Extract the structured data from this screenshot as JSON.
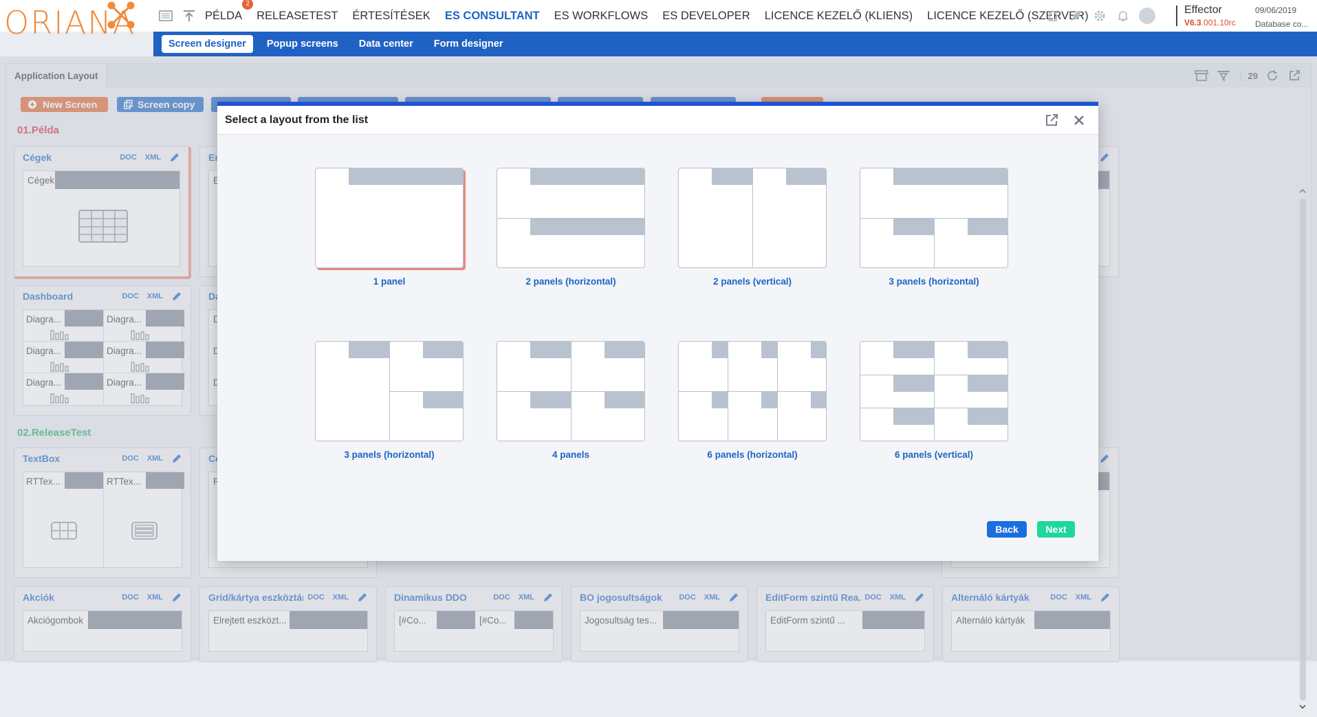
{
  "brand": {
    "logo_text": "ORIANA"
  },
  "nav": {
    "items": [
      {
        "label": "PÉLDA",
        "badge": "2"
      },
      {
        "label": "RELEASETEST"
      },
      {
        "label": "ÉRTESÍTÉSEK"
      },
      {
        "label": "ES CONSULTANT",
        "active": true
      },
      {
        "label": "ES WORKFLOWS"
      },
      {
        "label": "ES DEVELOPER"
      },
      {
        "label": "LICENCE KEZELŐ (KLIENS)"
      },
      {
        "label": "LICENCE KEZELŐ (SZERVER)"
      }
    ]
  },
  "app": {
    "name": "Effector",
    "version_main": "V6.3",
    "version_rest": ".001.10rc",
    "date": "09/06/2019",
    "database": "Database co..."
  },
  "subnav": {
    "items": [
      "Screen designer",
      "Popup screens",
      "Data center",
      "Form designer"
    ]
  },
  "tab": {
    "title": "Application Layout",
    "page_count": "29"
  },
  "toolbar": {
    "new_screen": "New Screen",
    "screen_copy": "Screen copy"
  },
  "groups": {
    "g1": "01.Példa",
    "g2": "02.ReleaseTest"
  },
  "cards": {
    "cegek": {
      "title": "Cégek",
      "doc": "DOC",
      "xml": "XML",
      "label": "Cégek"
    },
    "en": {
      "title": "En",
      "label": "E"
    },
    "dashboard": {
      "title": "Dashboard",
      "doc": "DOC",
      "xml": "XML",
      "cells": [
        "Diagra...",
        "Diagra...",
        "Diagra...",
        "Diagra...",
        "Diagra...",
        "Diagra..."
      ]
    },
    "da": {
      "title": "Da",
      "cells": [
        "D",
        "D",
        "D"
      ]
    },
    "textbox": {
      "title": "TextBox",
      "doc": "DOC",
      "xml": "XML",
      "cells": [
        "RTTex...",
        "RTTex..."
      ]
    },
    "co": {
      "title": "Co",
      "label": "R"
    },
    "akciok": {
      "title": "Akciók",
      "doc": "DOC",
      "xml": "XML",
      "label": "Akciógombok"
    },
    "grid": {
      "title": "Grid/kártya eszköztár",
      "doc": "DOC",
      "xml": "XML",
      "label": "Elrejtett eszközt..."
    },
    "ddo": {
      "title": "Dinamikus DDO",
      "doc": "DOC",
      "xml": "XML",
      "cells": [
        "[#Co...",
        "[#Co..."
      ]
    },
    "bo": {
      "title": "BO jogosultságok",
      "doc": "DOC",
      "xml": "XML",
      "label": "Jogosultság tes..."
    },
    "editform": {
      "title": "EditForm szintű Rea...",
      "doc": "DOC",
      "xml": "XML",
      "label": "EditForm szintű ..."
    },
    "alternalo": {
      "title": "Alternáló kártyák",
      "doc": "DOC",
      "xml": "XML",
      "label": "Alternáló kártyák"
    }
  },
  "modal": {
    "title": "Select a layout from the list",
    "options": [
      "1 panel",
      "2 panels (horizontal)",
      "2 panels (vertical)",
      "3 panels (horizontal)",
      "3 panels (horizontal)",
      "4 panels",
      "6 panels (horizontal)",
      "6 panels (vertical)"
    ],
    "back": "Back",
    "next": "Next"
  },
  "colors": {
    "accent": "#2062c4",
    "brand": "#f08a3c",
    "danger": "#e8603c",
    "next": "#1ed79a",
    "back": "#1a6fe0"
  }
}
